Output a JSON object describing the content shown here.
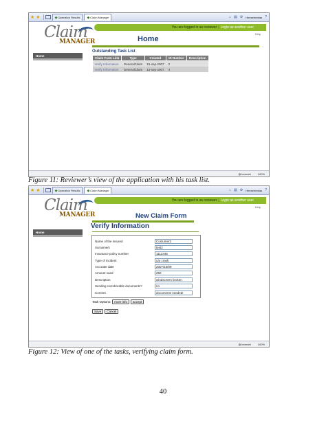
{
  "fig11": {
    "tabs": [
      "Operation Results",
      "Claim Manager"
    ],
    "toolbar_right": "Herramientas",
    "logo_main": "Claim",
    "logo_sub": "MANAGER",
    "login_text": "You are logged in as reviewer",
    "login_sep": "|",
    "login_link": "Login as another user",
    "help": "Help",
    "sidebar": "Home",
    "page_title": "Home",
    "section_title": "Outstanding Task List",
    "columns": [
      "Claim Form Link",
      "Type",
      "Created",
      "ID Number",
      "Description"
    ],
    "rows": [
      [
        "Verify Information",
        "GeneralClaim",
        "15-sep-2007",
        "2",
        ""
      ],
      [
        "Verify Information",
        "GeneralClaim",
        "15-sep-2007",
        "4",
        ""
      ]
    ],
    "status_zone": "Internet",
    "zoom": "100%"
  },
  "caption11": "Figure 11: Reviewer’s view of the application with his task list.",
  "fig12": {
    "tabs": [
      "Operation Results",
      "Claim Manager"
    ],
    "toolbar_right": "Herramientas",
    "logo_main": "Claim",
    "logo_sub": "MANAGER",
    "login_text": "You are logged in as reviewer",
    "login_sep": "|",
    "login_link": "Login as another user",
    "help": "Help",
    "sidebar": "Home",
    "page_title": "New Claim Form",
    "form_heading": "Verify Information",
    "fields": [
      {
        "label": "Name of the insured",
        "value": "Costumer2"
      },
      {
        "label": "Surname/s",
        "value": "test2"
      },
      {
        "label": "Insurance policy number",
        "value": "1112345"
      },
      {
        "label": "Type of incident",
        "value": "car crash"
      },
      {
        "label": "Accurate date",
        "value": "2007/10/09"
      },
      {
        "label": "Amount sued",
        "value": "250"
      },
      {
        "label": "Description",
        "value": "windscreen broken"
      },
      {
        "label": "Sending corroborable documents?",
        "value": "no"
      },
      {
        "label": "Coment",
        "value": "documents needed!"
      }
    ],
    "task_options_label": "Task Options:",
    "more_info": "more info",
    "accept": "accept",
    "save": "Save",
    "cancel": "Cancel",
    "status_zone": "Internet",
    "zoom": "100%"
  },
  "caption12": "Figure 12: View of one of the tasks, verifying claim form.",
  "page_number": "40"
}
